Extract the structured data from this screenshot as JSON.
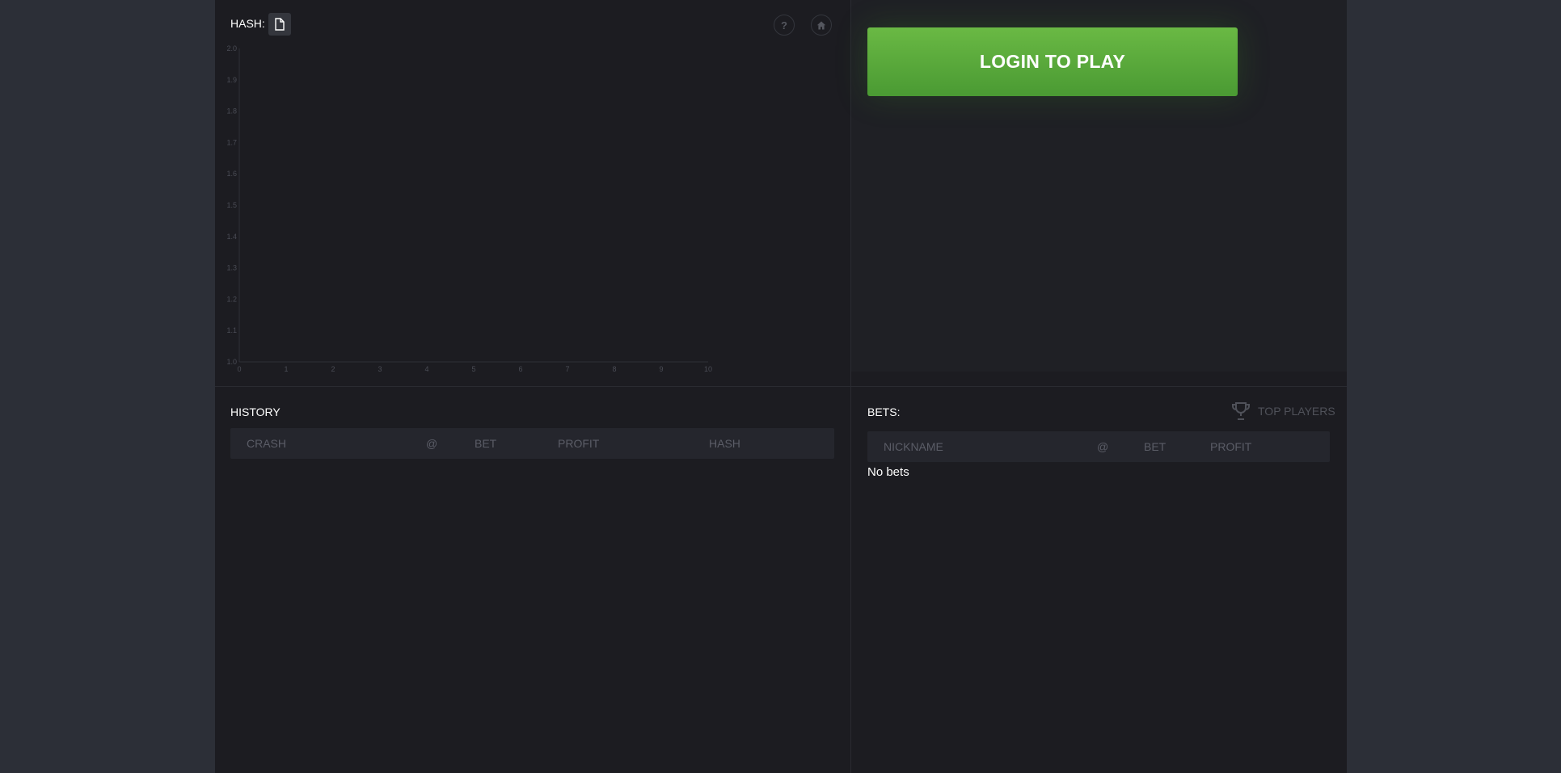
{
  "chart_area": {
    "hash_label": "HASH:",
    "chart_data": {
      "type": "line",
      "x_ticks": [
        "0",
        "1",
        "2",
        "3",
        "4",
        "5",
        "6",
        "7",
        "8",
        "9",
        "10"
      ],
      "y_ticks": [
        "1.0",
        "1.1",
        "1.2",
        "1.3",
        "1.4",
        "1.5",
        "1.6",
        "1.7",
        "1.8",
        "1.9",
        "2.0"
      ],
      "xlim": [
        0,
        10
      ],
      "ylim": [
        1.0,
        2.0
      ],
      "series": []
    }
  },
  "controls": {
    "help_label": "?",
    "login_label": "LOGIN TO PLAY"
  },
  "history": {
    "title": "HISTORY",
    "columns": [
      "CRASH",
      "@",
      "BET",
      "PROFIT",
      "HASH"
    ]
  },
  "bets": {
    "title": "BETS:",
    "top_players_label": "TOP PLAYERS",
    "columns": [
      "NICKNAME",
      "@",
      "BET",
      "PROFIT"
    ],
    "empty_text": "No bets"
  },
  "colors": {
    "background": "#2c2f37",
    "panel": "#1c1c21",
    "accent_green": "#5aa83c",
    "muted_text": "#5b5d67"
  }
}
